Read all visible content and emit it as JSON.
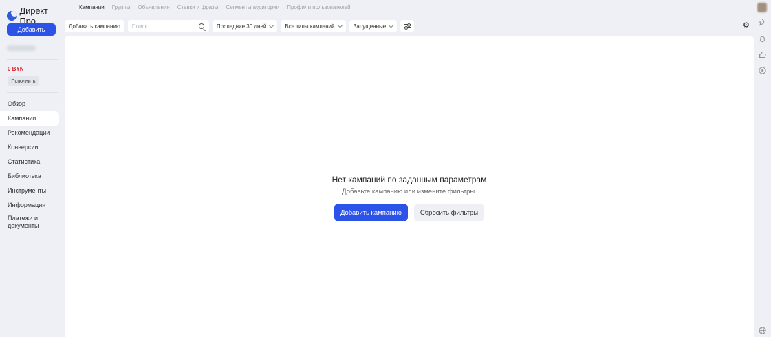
{
  "app": {
    "name": "Директ Про",
    "add_button": "Добавить"
  },
  "account": {
    "balance": "0 BYN",
    "topup_button": "Пополнить"
  },
  "nav": {
    "items": [
      {
        "label": "Обзор"
      },
      {
        "label": "Кампании"
      },
      {
        "label": "Рекомендации"
      },
      {
        "label": "Конверсии"
      },
      {
        "label": "Статистика"
      },
      {
        "label": "Библиотека"
      },
      {
        "label": "Инструменты"
      },
      {
        "label": "Информация"
      },
      {
        "label": "Платежи и документы"
      }
    ],
    "active": "Кампании"
  },
  "tabs": [
    {
      "label": "Кампании"
    },
    {
      "label": "Группы"
    },
    {
      "label": "Объявления"
    },
    {
      "label": "Ставки и фразы"
    },
    {
      "label": "Сегменты аудитории"
    },
    {
      "label": "Профили пользователей"
    }
  ],
  "toolbar": {
    "add_campaign": "Добавить кампанию",
    "search_placeholder": "Поиск",
    "period": "Последние 30 дней",
    "campaign_types": "Все типы кампаний",
    "status": "Запущенные"
  },
  "empty_state": {
    "title": "Нет кампаний по заданным параметрам",
    "subtitle": "Добавьте кампанию или измените фильтры.",
    "primary_button": "Добавить кампанию",
    "secondary_button": "Сбросить фильтры"
  },
  "rail": {
    "icons": [
      "chat-icon",
      "bell-icon",
      "thumbs-up-icon",
      "play-icon",
      "globe-icon"
    ]
  },
  "colors": {
    "accent": "#2c53e8",
    "balance": "#e0232e",
    "background": "#eef0f5"
  }
}
